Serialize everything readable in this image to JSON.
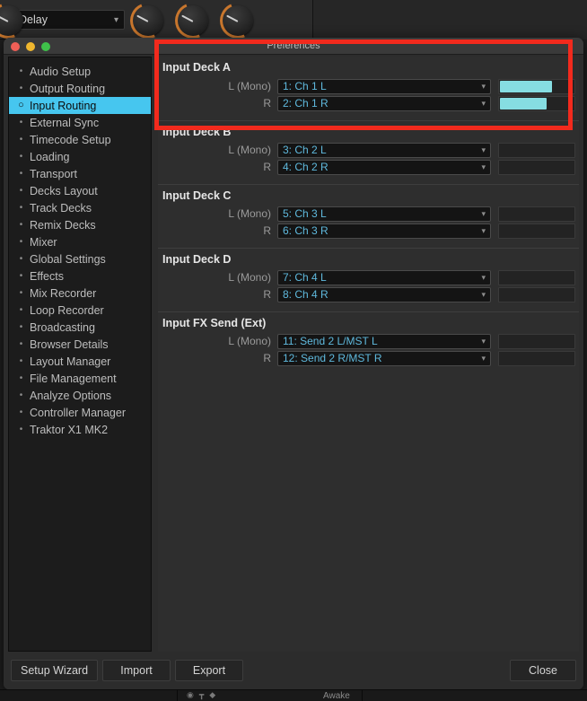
{
  "top_bar": {
    "fx_select": {
      "value": "Delay",
      "chevron": "chevron-down-icon"
    },
    "knob_count": 3
  },
  "window": {
    "title": "Preferences",
    "traffic_lights": [
      "close-red",
      "minimize-amber",
      "zoom-green"
    ]
  },
  "sidebar": {
    "items": [
      {
        "label": "Audio Setup",
        "active": false
      },
      {
        "label": "Output Routing",
        "active": false
      },
      {
        "label": "Input Routing",
        "active": true
      },
      {
        "label": "External Sync",
        "active": false
      },
      {
        "label": "Timecode Setup",
        "active": false
      },
      {
        "label": "Loading",
        "active": false
      },
      {
        "label": "Transport",
        "active": false
      },
      {
        "label": "Decks Layout",
        "active": false
      },
      {
        "label": "Track Decks",
        "active": false
      },
      {
        "label": "Remix Decks",
        "active": false
      },
      {
        "label": "Mixer",
        "active": false
      },
      {
        "label": "Global Settings",
        "active": false
      },
      {
        "label": "Effects",
        "active": false
      },
      {
        "label": "Mix Recorder",
        "active": false
      },
      {
        "label": "Loop Recorder",
        "active": false
      },
      {
        "label": "Broadcasting",
        "active": false
      },
      {
        "label": "Browser Details",
        "active": false
      },
      {
        "label": "Layout Manager",
        "active": false
      },
      {
        "label": "File Management",
        "active": false
      },
      {
        "label": "Analyze Options",
        "active": false
      },
      {
        "label": "Controller Manager",
        "active": false
      },
      {
        "label": "Traktor X1 MK2",
        "active": false
      }
    ]
  },
  "content": {
    "sections": [
      {
        "title": "Input Deck A",
        "highlighted": true,
        "rows": [
          {
            "label": "L (Mono)",
            "value": "1: Ch 1 L",
            "meter_percent": 72
          },
          {
            "label": "R",
            "value": "2: Ch 1 R",
            "meter_percent": 64
          }
        ]
      },
      {
        "title": "Input Deck B",
        "highlighted": false,
        "rows": [
          {
            "label": "L (Mono)",
            "value": "3: Ch 2 L",
            "meter_percent": 0
          },
          {
            "label": "R",
            "value": "4: Ch 2 R",
            "meter_percent": 0
          }
        ]
      },
      {
        "title": "Input Deck C",
        "highlighted": false,
        "rows": [
          {
            "label": "L (Mono)",
            "value": "5: Ch 3 L",
            "meter_percent": 0
          },
          {
            "label": "R",
            "value": "6: Ch 3 R",
            "meter_percent": 0
          }
        ]
      },
      {
        "title": "Input Deck D",
        "highlighted": false,
        "rows": [
          {
            "label": "L (Mono)",
            "value": "7: Ch 4 L",
            "meter_percent": 0
          },
          {
            "label": "R",
            "value": "8: Ch 4 R",
            "meter_percent": 0
          }
        ]
      },
      {
        "title": "Input FX Send (Ext)",
        "highlighted": false,
        "rows": [
          {
            "label": "L (Mono)",
            "value": "11: Send 2 L/MST L",
            "meter_percent": 0
          },
          {
            "label": "R",
            "value": "12: Send 2 R/MST R",
            "meter_percent": 0
          }
        ]
      }
    ]
  },
  "footer": {
    "setup_wizard": "Setup Wizard",
    "import": "Import",
    "export": "Export",
    "close": "Close"
  },
  "status_bar": {
    "awake": "Awake",
    "icons": [
      "headphones-icon",
      "pin-icon",
      "person-icon"
    ]
  },
  "colors": {
    "accent_selected": "#46c6ef",
    "combo_text": "#5fb9dd",
    "meter_fill": "#86dde2",
    "annotation": "#f22a1d",
    "knob_arc": "#c8762d"
  }
}
